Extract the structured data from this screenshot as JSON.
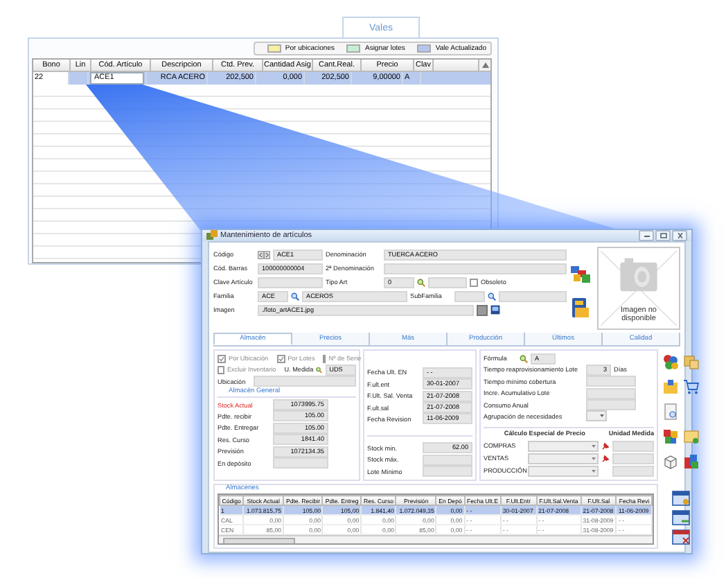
{
  "back_window": {
    "tabs": [
      {
        "label": "Vales",
        "selected": true
      }
    ],
    "legend": [
      {
        "label": "Por ubicaciones",
        "color": "#f6f0a2"
      },
      {
        "label": "Asignar lotes",
        "color": "#c6efd6"
      },
      {
        "label": "Vale Actualizado",
        "color": "#b4c6ee"
      }
    ],
    "columns": [
      "Bono",
      "Lin",
      "Cód. Artículo",
      "Descripcion",
      "Ctd. Prev.",
      "Cantidad Asig",
      "Cant.Real.",
      "Precio",
      "Clav"
    ],
    "rows": [
      {
        "cells": [
          "22",
          "",
          "ACE1",
          "RCA ACERO",
          "202,500",
          "0,000",
          "202,500",
          "9,00000",
          "A"
        ],
        "selected": true
      }
    ]
  },
  "dialog": {
    "title": "Mantenimiento de artículos",
    "header": {
      "codigo": {
        "label": "Código",
        "value": "ACE1"
      },
      "denominacion": {
        "label": "Denominación",
        "value": "TUERCA ACERO"
      },
      "cod_barras": {
        "label": "Cód. Barras",
        "value": "100000000004"
      },
      "denominacion_2": {
        "label": "2ª Denominación"
      },
      "clave_articulo": {
        "label": "Clave Artículo"
      },
      "tipo_art": {
        "label": "Tipo Art",
        "value": "0"
      },
      "obsoleto": {
        "label": "Obsoleto",
        "checked": false
      },
      "familia": {
        "label": "Familia",
        "code": "ACE",
        "name": "ACEROS"
      },
      "subfamilia": {
        "label": "SubFamilia"
      },
      "imagen": {
        "label": "Imagen",
        "value": "./foto_artACE1.jpg"
      }
    },
    "image_placeholder": "Imagen no disponible",
    "tabs": [
      {
        "label": "Almacén",
        "selected": true
      },
      {
        "label": "Precios",
        "selected": false
      },
      {
        "label": "Más",
        "selected": false
      },
      {
        "label": "Producción",
        "selected": false
      },
      {
        "label": "Últimos",
        "selected": false
      },
      {
        "label": "Calidad",
        "selected": false
      }
    ],
    "options": [
      {
        "label": "Por Ubicación",
        "checked": true
      },
      {
        "label": "Por Lotes",
        "checked": true
      },
      {
        "label": "Nº de Serie",
        "checked": false
      },
      {
        "label": "Excluir Inventario",
        "checked": false
      }
    ],
    "u_medida": {
      "label": "U. Medida",
      "value": "UDS"
    },
    "ubicacion": {
      "label": "Ubicación"
    },
    "almacen_general": {
      "title": "Almacén General",
      "fields": [
        {
          "label": "Stock Actual",
          "value": "1073995.75",
          "alert": true
        },
        {
          "label": "Pdte. recibir",
          "value": "105.00",
          "alert": false
        },
        {
          "label": "Pdte. Entregar",
          "value": "105.00",
          "alert": false
        },
        {
          "label": "Res. Curso",
          "value": "1841.40",
          "alert": false
        },
        {
          "label": "Previsión",
          "value": "1072134.35",
          "alert": false
        },
        {
          "label": "En depósito",
          "alert": false
        }
      ]
    },
    "fechas": [
      {
        "label": "Fecha Ult. EN",
        "value": "- -"
      },
      {
        "label": "F.ult.ent",
        "value": "30-01-2007"
      },
      {
        "label": "F.Ult. Sal. Venta",
        "value": "21-07-2008"
      },
      {
        "label": "F.ult.sal",
        "value": "21-07-2008"
      },
      {
        "label": "Fecha Revision",
        "value": "11-06-2009"
      }
    ],
    "stock_limits": [
      {
        "label": "Stock min.",
        "value": "62.00"
      },
      {
        "label": "Stock máx."
      },
      {
        "label": "Lote Mínimo"
      }
    ],
    "formula": {
      "label": "Fórmula",
      "value": "A"
    },
    "planning": [
      {
        "label": "Tiempo reaprovisionamiento Lote",
        "value": "3",
        "unit": "Días",
        "kind": "field"
      },
      {
        "label": "Tiempo mínimo cobertura",
        "kind": "field"
      },
      {
        "label": "Incre. Acumulativo Lote",
        "kind": "field"
      },
      {
        "label": "Consumo Anual",
        "kind": "field"
      },
      {
        "label": "Agrupación de necesidades",
        "kind": "dropdown"
      }
    ],
    "precio_especial": {
      "title": "Cálculo Especial de Precio",
      "unit_title": "Unidad Medida",
      "rows": [
        {
          "label": "COMPRAS",
          "pin": true
        },
        {
          "label": "VENTAS",
          "pin": true
        },
        {
          "label": "PRODUCCIÓN",
          "pin": false
        }
      ]
    },
    "almacenes": {
      "title": "Almacenes",
      "columns": [
        "Código",
        "Stock Actual",
        "Pdte. Recibir",
        "Pdte. Entreg",
        "Res. Curso",
        "Previsión",
        "En Depó",
        "Fecha Ult.E",
        "F.Ult.Entr",
        "F.Ult.Sal.Venta",
        "F.Ult.Sal",
        "Fecha Revi"
      ],
      "rows": [
        {
          "cells": [
            "1",
            "1.073.815,75",
            "105,00",
            "105,00",
            "1.841,40",
            "1.072.049,35",
            "0,00",
            "- -",
            "30-01-2007",
            "21-07-2008",
            "21-07-2008",
            "11-06-2009"
          ],
          "selected": true
        },
        {
          "cells": [
            "CAL",
            "0,00",
            "0,00",
            "0,00",
            "0,00",
            "0,00",
            "0,00",
            "- -",
            "- -",
            "- -",
            "31-08-2009",
            "- -"
          ],
          "selected": false
        },
        {
          "cells": [
            "CEN",
            "85,00",
            "0,00",
            "0,00",
            "0,00",
            "85,00",
            "0,00",
            "- -",
            "- -",
            "- -",
            "31-08-2009",
            "- -"
          ],
          "selected": false
        }
      ]
    }
  }
}
